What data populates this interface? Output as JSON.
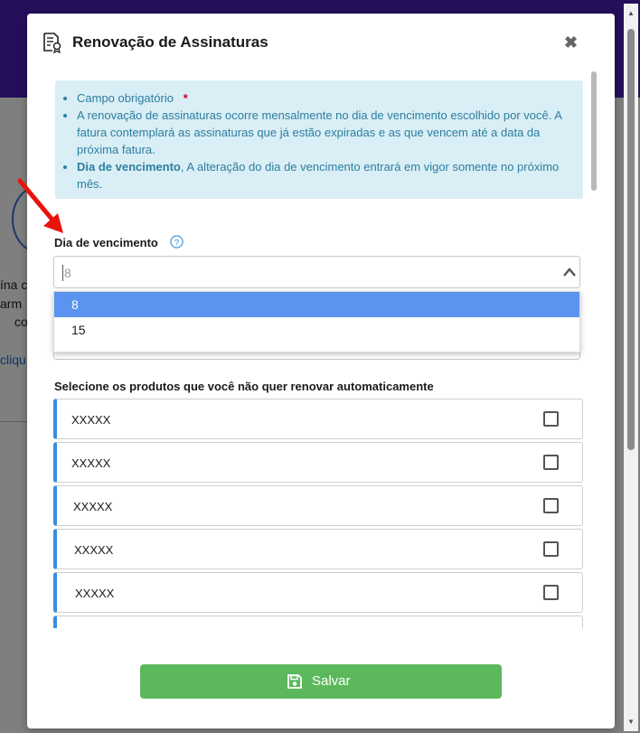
{
  "background": {
    "fragments": [
      "ína c",
      "arm",
      "co"
    ],
    "link_fragment": "cliqu"
  },
  "modal": {
    "title": "Renovação de Assinaturas",
    "close_label": "✖"
  },
  "info": {
    "required_text": "Campo obrigatório",
    "required_mark": "*",
    "renewal_text": "A renovação de assinaturas ocorre mensalmente no dia de vencimento escolhido por você. A fatura contemplará as assinaturas que já estão expiradas e as que vencem até a data da próxima fatura.",
    "due_bold": "Dia de vencimento",
    "due_text": ", A alteração do dia de vencimento entrará em vigor somente no próximo mês."
  },
  "due_day": {
    "label": "Dia de vencimento",
    "value": "8",
    "options": [
      "8",
      "15"
    ],
    "selected_index": 0
  },
  "products": {
    "label": "Selecione os produtos que você não quer renovar automaticamente",
    "items": [
      {
        "name": "XXXXX",
        "checked": false
      },
      {
        "name": "XXXXX",
        "checked": false
      },
      {
        "name": "XXXXX",
        "checked": false
      },
      {
        "name": "XXXXX",
        "checked": false
      },
      {
        "name": "XXXXX",
        "checked": false
      },
      {
        "name": "",
        "checked": false
      }
    ]
  },
  "save_button": {
    "label": "Salvar"
  },
  "colors": {
    "header_purple": "#4a1fb8",
    "info_bg": "#d9eef5",
    "info_text": "#2d7ea0",
    "selected_option": "#5a94f0",
    "product_accent": "#3a8de0",
    "save_green": "#5cb85c",
    "annotation_arrow": "#e8140c"
  },
  "icons": {
    "header": "certificate-document-icon",
    "help": "question-circle-icon",
    "chevron": "chevron-up-icon",
    "save": "floppy-disk-icon",
    "close": "close-icon"
  }
}
